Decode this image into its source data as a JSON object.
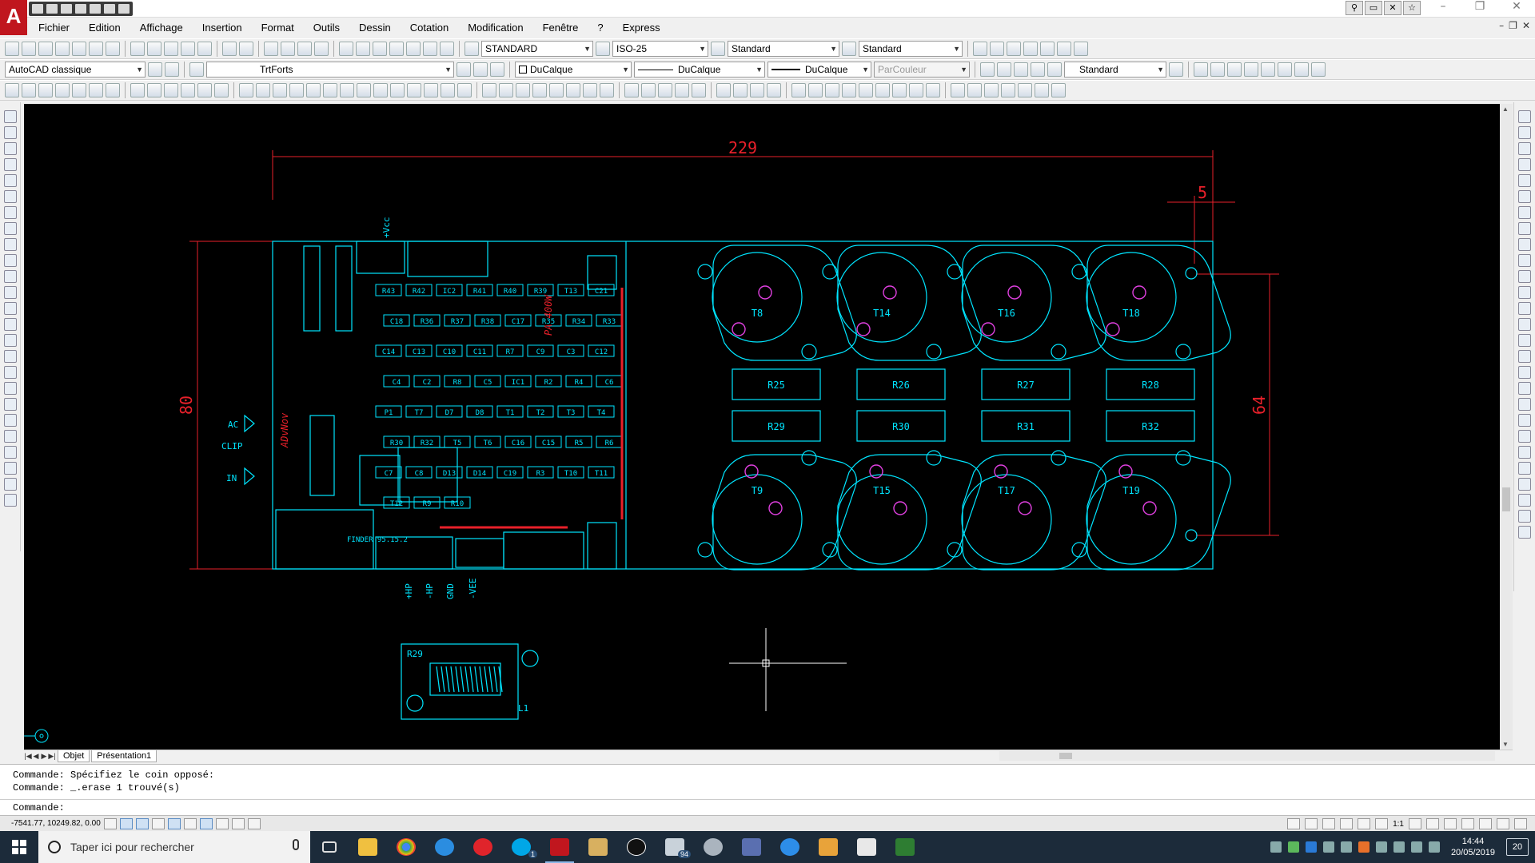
{
  "app": {
    "logo": "A"
  },
  "menu": [
    "Fichier",
    "Edition",
    "Affichage",
    "Insertion",
    "Format",
    "Outils",
    "Dessin",
    "Cotation",
    "Modification",
    "Fenêtre",
    "?",
    "Express"
  ],
  "toolbar1": {
    "text_style": "STANDARD",
    "dim_style": "ISO-25",
    "table_style": "Standard",
    "mleader_style": "Standard"
  },
  "toolbar2": {
    "workspace": "AutoCAD classique",
    "layer": "TrtForts",
    "color": "DuCalque",
    "linetype": "DuCalque",
    "lineweight": "DuCalque",
    "plotstyle": "ParCouleur",
    "visual_style": "Standard"
  },
  "drawing": {
    "dim_top": "229",
    "dim_small": "5",
    "dim_left": "80",
    "dim_right": "64",
    "left_labels": [
      "AC",
      "CLIP",
      "IN"
    ],
    "brand_text": "ADvNov",
    "bottom_pins": [
      "+HP",
      "-HP",
      "GND",
      "-VEE"
    ],
    "vcc_label": "+Vcc",
    "transistors_top": [
      "T8",
      "T14",
      "T16",
      "T18"
    ],
    "transistors_bottom": [
      "T9",
      "T15",
      "T17",
      "T19"
    ],
    "resistors_row1": [
      "R25",
      "R26",
      "R27",
      "R28"
    ],
    "resistors_row2": [
      "R29",
      "R30",
      "R31",
      "R32"
    ],
    "small_parts": [
      "R43",
      "R42",
      "IC2",
      "R41",
      "R40",
      "R39",
      "T13",
      "C21",
      "C18",
      "R36",
      "R37",
      "R38",
      "C17",
      "R35",
      "R34",
      "R33",
      "C14",
      "C13",
      "C10",
      "C11",
      "R7",
      "C9",
      "C3",
      "C12",
      "C4",
      "C2",
      "R8",
      "C5",
      "IC1",
      "R2",
      "R4",
      "C6",
      "P1",
      "T7",
      "D7",
      "D8",
      "T1",
      "T2",
      "T3",
      "T4",
      "R30",
      "R32",
      "T5",
      "T6",
      "C16",
      "C15",
      "R5",
      "R6",
      "C7",
      "C8",
      "D13",
      "D14",
      "C19",
      "R3",
      "T10",
      "T11",
      "T12",
      "R9",
      "R10"
    ],
    "pa_label": "PA 400W",
    "relay": "FINDER 95.15.2",
    "coil_label_r": "R29",
    "coil_label_l": "L1"
  },
  "tabs": [
    "Objet",
    "Présentation1"
  ],
  "command_history": [
    "Commande: Spécifiez le coin opposé:",
    "Commande: _.erase 1 trouvé(s)"
  ],
  "command_prompt": "Commande:",
  "status": {
    "coords": "-7541.77, 10249.82, 0.00",
    "scale": "1:1"
  },
  "taskbar": {
    "search_placeholder": "Taper ici pour rechercher",
    "mail_badge": "94",
    "skype_badge": "1",
    "time": "14:44",
    "date": "20/05/2019",
    "notifications": "20"
  }
}
